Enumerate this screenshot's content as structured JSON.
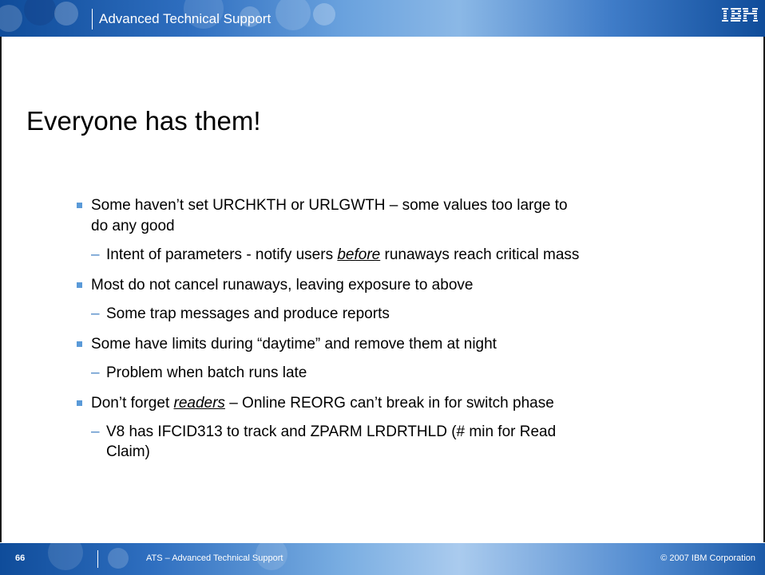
{
  "header": {
    "title": "Advanced Technical Support",
    "logo": "IBM"
  },
  "slide": {
    "title": "Everyone has them!",
    "bullets": [
      {
        "line1": "Some haven’t set URCHKTH or URLGWTH  – some values too large to",
        "line2": "do any good"
      },
      {
        "pre": "Intent of parameters - notify users ",
        "em": "before",
        "post": " runaways reach critical mass"
      },
      {
        "text": "Most do not cancel runaways, leaving exposure to above"
      },
      {
        "text": "Some trap messages and produce reports"
      },
      {
        "text": "Some have limits during “daytime” and remove them at night"
      },
      {
        "text": "Problem when batch runs late"
      },
      {
        "pre": "Don’t forget ",
        "em": "readers",
        "post": " – Online REORG can’t break in for switch phase"
      },
      {
        "line1": "V8 has IFCID313 to track and ZPARM LRDRTHLD (# min for Read",
        "line2": "Claim)"
      }
    ]
  },
  "footer": {
    "page_number": "66",
    "text": "ATS – Advanced Technical Support",
    "copyright": "© 2007 IBM Corporation"
  },
  "colors": {
    "band_blue": "#2f6fc0",
    "bullet_square": "#5a9ad8",
    "dash": "#4a86c6"
  },
  "icons": {
    "bullet": "square-bullet-icon",
    "sub_bullet": "dash-icon",
    "logo": "ibm-logo-icon"
  }
}
